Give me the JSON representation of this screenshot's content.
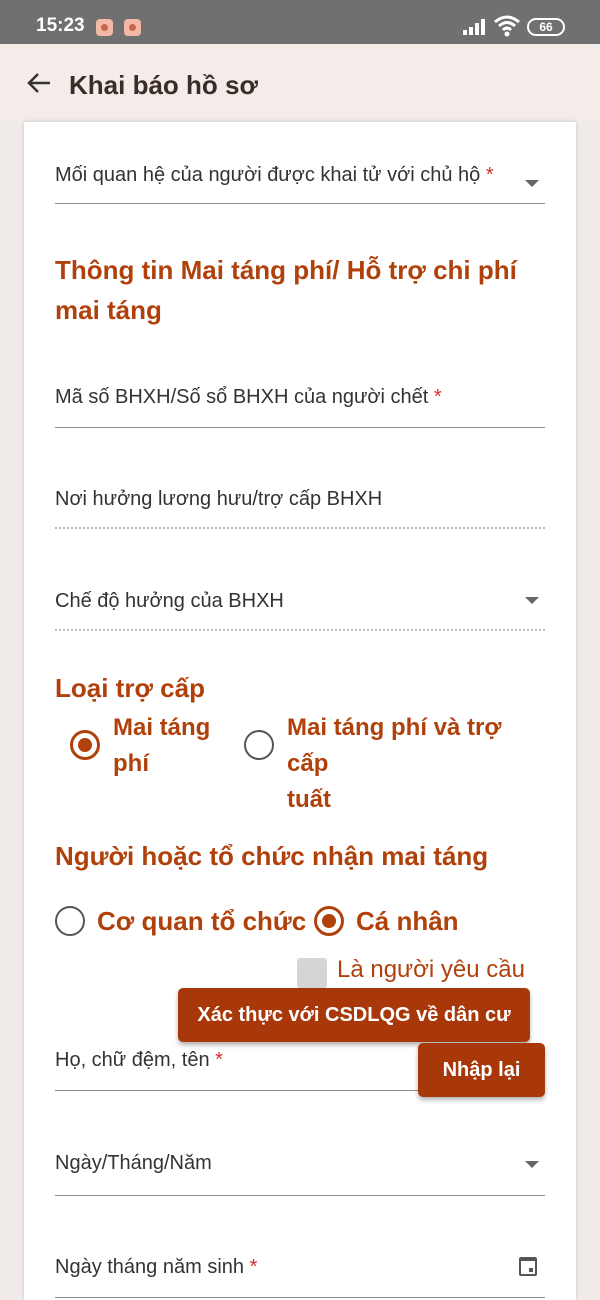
{
  "status_bar": {
    "time": "15:23",
    "battery": "66"
  },
  "app_bar": {
    "title": "Khai báo hồ sơ"
  },
  "form": {
    "relation_field": {
      "label": "Mối quan hệ của người được khai tử với chủ hộ",
      "required": "*"
    },
    "section_funeral": {
      "title": "Thông tin Mai táng phí/ Hỗ trợ chi phí mai táng"
    },
    "social_insurance_field": {
      "label": "Mã số BHXH/Số sổ BHXH của người chết",
      "required": "*"
    },
    "pension_place_field": {
      "label": "Nơi hưởng lương hưu/trợ cấp BHXH"
    },
    "benefit_regime_field": {
      "label": "Chế độ hưởng của BHXH"
    },
    "section_allowance_type": {
      "title": "Loại trợ cấp"
    },
    "allowance_options": [
      {
        "line1": "Mai táng",
        "line2": "phí",
        "selected": true
      },
      {
        "line1": "Mai táng phí và trợ cấp",
        "line2": "tuất",
        "selected": false
      }
    ],
    "section_recipient": {
      "title": "Người hoặc tổ chức nhận mai táng"
    },
    "recipient_options": [
      {
        "label": "Cơ quan tổ chức",
        "selected": false
      },
      {
        "label": "Cá nhân",
        "selected": true
      }
    ],
    "is_requester_checkbox": {
      "label": "Là người yêu cầu",
      "checked": false
    },
    "verify_button": {
      "label": "Xác thực với CSDLQG về dân cư"
    },
    "reset_button": {
      "label": "Nhập lại"
    },
    "full_name_field": {
      "label": "Họ, chữ đệm, tên",
      "required": "*"
    },
    "date_format_field": {
      "label": "Ngày/Tháng/Năm"
    },
    "birth_date_field": {
      "label": "Ngày tháng năm sinh",
      "required": "*"
    }
  }
}
